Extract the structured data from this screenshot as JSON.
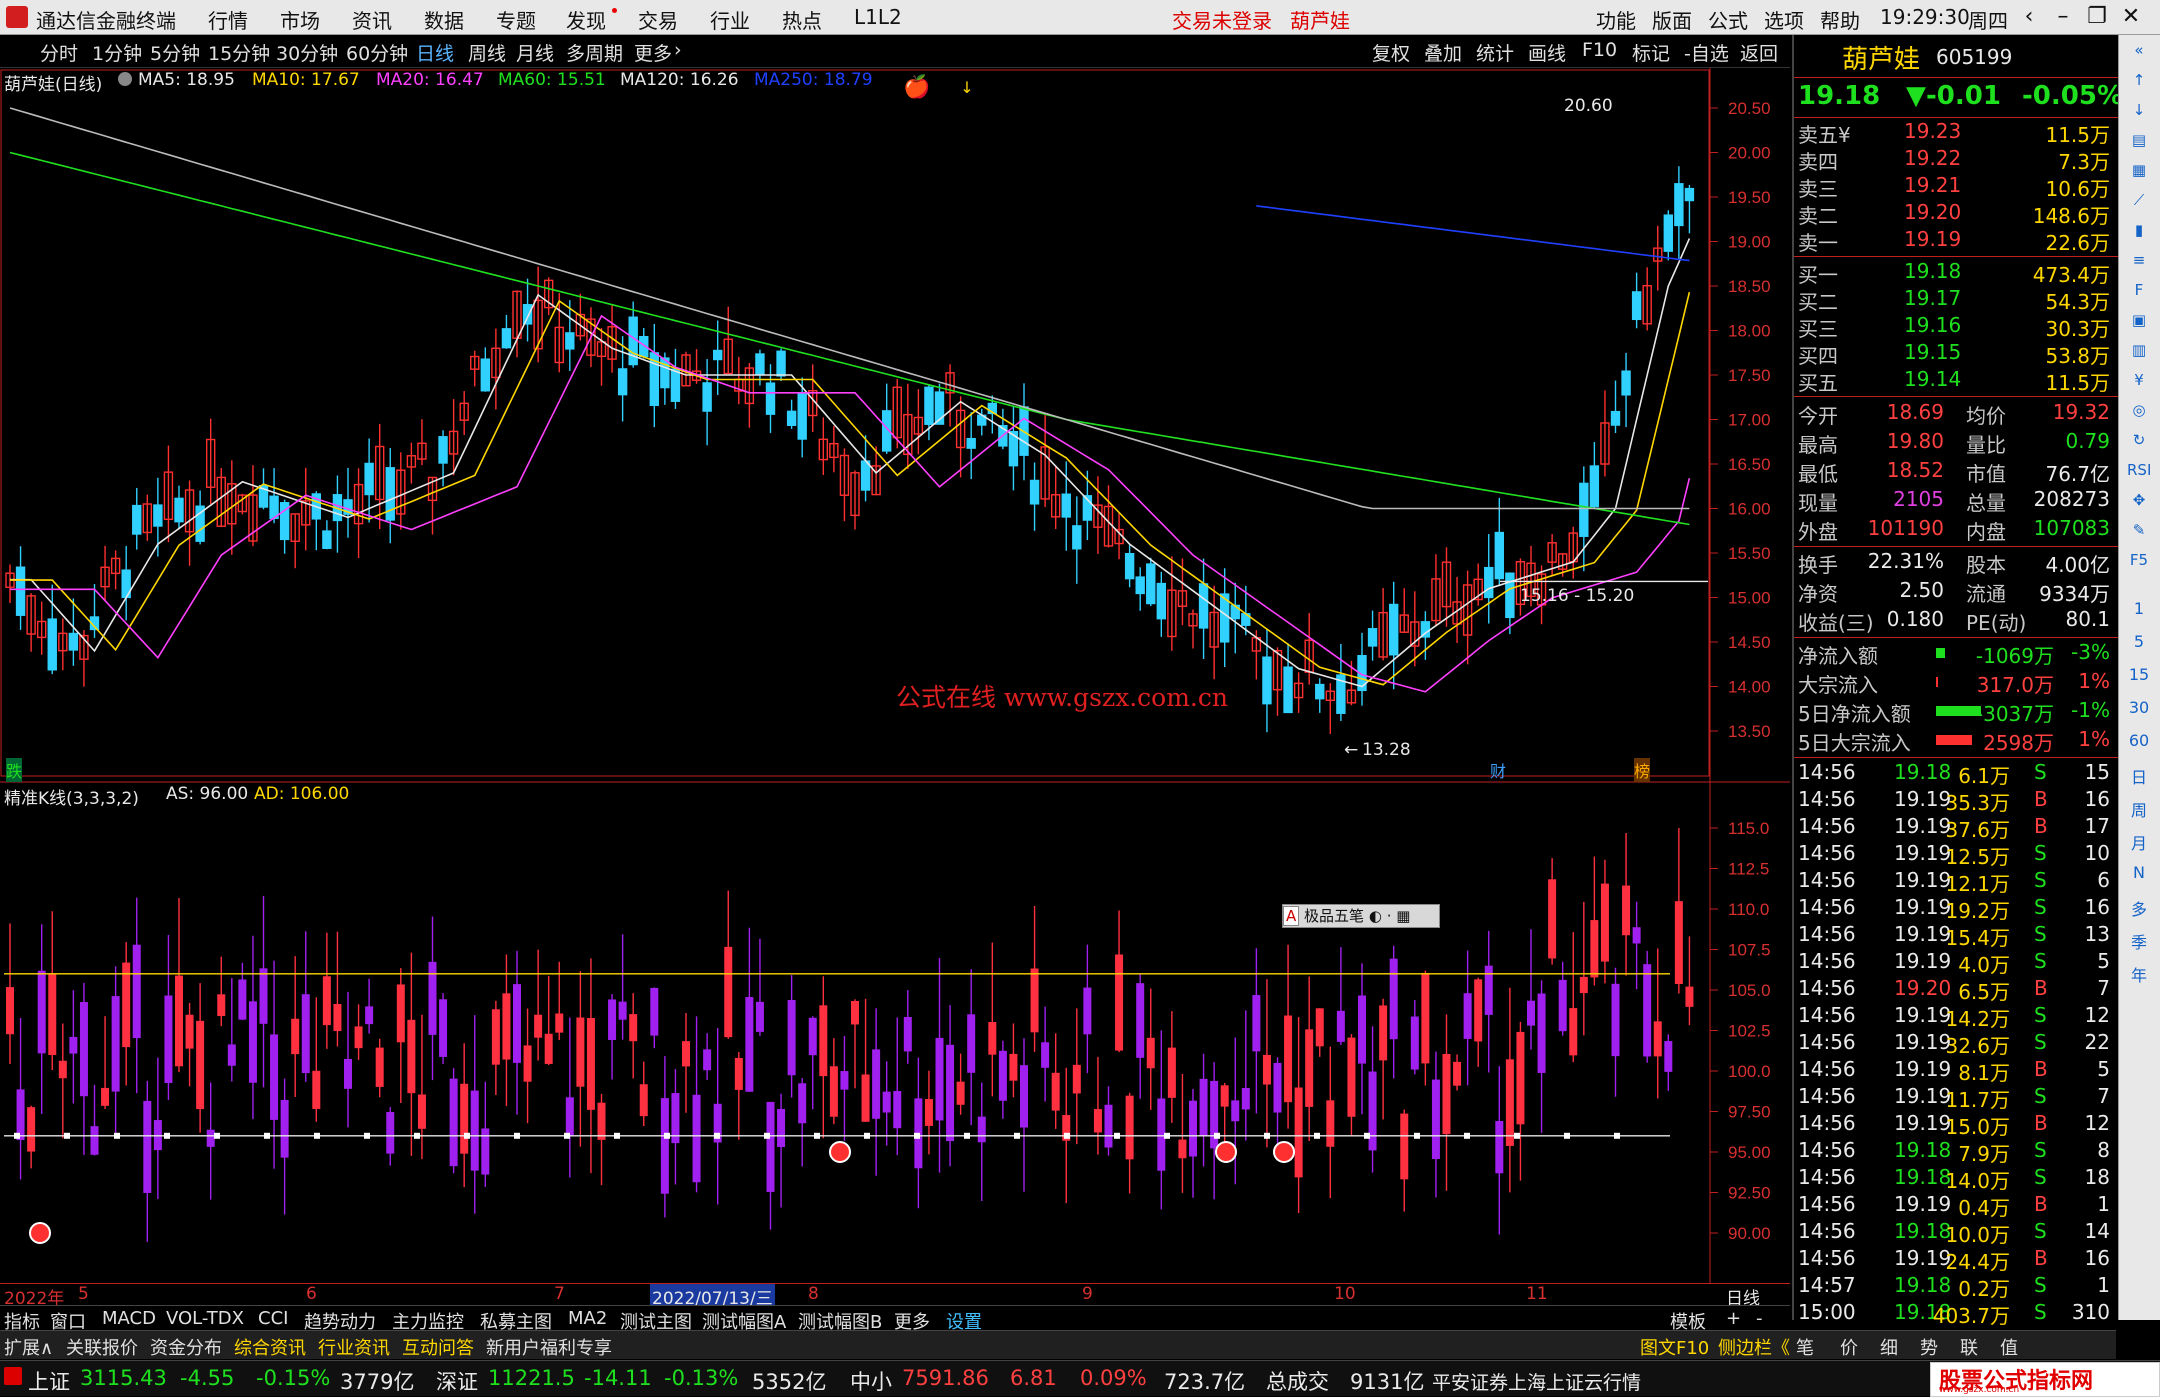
{
  "titlebar": {
    "app_title": "通达信金融终端",
    "menus": [
      "行情",
      "市场",
      "资讯",
      "数据",
      "专题",
      "发现",
      "交易",
      "行业",
      "热点",
      "L1L2"
    ],
    "login_status": "交易未登录",
    "stock_name": "葫芦娃",
    "right_menus": [
      "功能",
      "版面",
      "公式",
      "选项",
      "帮助"
    ],
    "time": "19:29:30",
    "weekday": "周四"
  },
  "toolbar": {
    "periods": [
      "分时",
      "1分钟",
      "5分钟",
      "15分钟",
      "30分钟",
      "60分钟",
      "日线",
      "周线",
      "月线",
      "多周期",
      "更多"
    ],
    "active_period": "日线",
    "right_buttons": [
      "复权",
      "叠加",
      "统计",
      "画线",
      "F10",
      "标记",
      "-自选",
      "返回"
    ]
  },
  "chart": {
    "stock_title": "葫芦娃(日线)",
    "ma_legend": [
      {
        "label": "MA5: 18.95",
        "color": "#e8e8e8"
      },
      {
        "label": "MA10: 17.67",
        "color": "#ffd700"
      },
      {
        "label": "MA20: 16.47",
        "color": "#ff40ff"
      },
      {
        "label": "MA60: 15.51",
        "color": "#20e020"
      },
      {
        "label": "MA120: 16.26",
        "color": "#e8e8e8"
      },
      {
        "label": "MA250: 18.79",
        "color": "#2040ff"
      }
    ],
    "price_axis": [
      "20.50",
      "20.00",
      "19.50",
      "19.00",
      "18.50",
      "18.00",
      "17.50",
      "17.00",
      "16.50",
      "16.00",
      "15.50",
      "15.00",
      "14.50",
      "14.00",
      "13.50"
    ],
    "high_marker": "20.60",
    "low_marker": "13.28",
    "range_label": "15.16 - 15.20",
    "watermark": "公式在线  www.gszx.com.cn",
    "tag_left": "跌",
    "tag_cai": "财",
    "tag_bang": "榜",
    "indicator_title": "精准K线(3,3,3,2)",
    "indicator_as": "AS: 96.00",
    "indicator_ad": "AD: 106.00",
    "indicator_axis": [
      "115.0",
      "112.5",
      "110.0",
      "107.5",
      "105.0",
      "102.5",
      "100.0",
      "97.50",
      "95.00",
      "92.50",
      "90.00"
    ],
    "ime_label": "极品五笔",
    "date_axis": [
      "2022年",
      "5",
      "6",
      "7",
      "2022/07/13/三",
      "8",
      "9",
      "10",
      "11"
    ],
    "date_axis_right": "日线"
  },
  "bottom_tabs": [
    "指标",
    "窗口",
    "MACD",
    "VOL-TDX",
    "CCI",
    "趋势动力",
    "主力监控",
    "私募主图",
    "MA2",
    "测试主图",
    "测试幅图A",
    "测试幅图B",
    "更多",
    "设置"
  ],
  "bottom_tabs_right": [
    "模板",
    "+",
    "-"
  ],
  "second_bar": [
    {
      "label": "扩展∧",
      "color": "#e0e0e0"
    },
    {
      "label": "关联报价",
      "color": "#e0e0e0"
    },
    {
      "label": "资金分布",
      "color": "#e0e0e0"
    },
    {
      "label": "综合资讯",
      "color": "#ffd700"
    },
    {
      "label": "行业资讯",
      "color": "#ffd700"
    },
    {
      "label": "互动问答",
      "color": "#ffd700"
    },
    {
      "label": "新用户福利专享",
      "color": "#e0e0e0"
    }
  ],
  "second_bar_right": [
    "图文F10",
    "侧边栏《",
    "笔",
    "价",
    "细",
    "势",
    "联",
    "值"
  ],
  "status": {
    "sh_label": "上证",
    "sh_value": "3115.43",
    "sh_change": "-4.55",
    "sh_pct": "-0.15%",
    "sh_amount": "3779亿",
    "sz_label": "深证",
    "sz_value": "11221.5",
    "sz_change": "-14.11",
    "sz_pct": "-0.13%",
    "sz_amount": "5352亿",
    "zx_label": "中小",
    "zx_value": "7591.86",
    "zx_change": "6.81",
    "zx_pct": "0.09%",
    "zx_amount": "723.7亿",
    "total_label": "总成交",
    "total_value": "9131亿",
    "broker": "平安证券上海上证云行情",
    "brand": "股票公式指标网",
    "brand_url": "www.gszx.com.cn"
  },
  "quote": {
    "name": "葫芦娃",
    "code": "605199",
    "price": "19.18",
    "change": "▼-0.01",
    "pct": "-0.05%",
    "sells": [
      {
        "label": "卖五¥",
        "price": "19.23",
        "vol": "11.5万"
      },
      {
        "label": "卖四",
        "price": "19.22",
        "vol": "7.3万"
      },
      {
        "label": "卖三",
        "price": "19.21",
        "vol": "10.6万"
      },
      {
        "label": "卖二",
        "price": "19.20",
        "vol": "148.6万"
      },
      {
        "label": "卖一",
        "price": "19.19",
        "vol": "22.6万"
      }
    ],
    "buys": [
      {
        "label": "买一",
        "price": "19.18",
        "vol": "473.4万"
      },
      {
        "label": "买二",
        "price": "19.17",
        "vol": "54.3万"
      },
      {
        "label": "买三",
        "price": "19.16",
        "vol": "30.3万"
      },
      {
        "label": "买四",
        "price": "19.15",
        "vol": "53.8万"
      },
      {
        "label": "买五",
        "price": "19.14",
        "vol": "11.5万"
      }
    ],
    "stats": [
      {
        "l1": "今开",
        "v1": "18.69",
        "c1": "red",
        "l2": "均价",
        "v2": "19.32",
        "c2": "red"
      },
      {
        "l1": "最高",
        "v1": "19.80",
        "c1": "red",
        "l2": "量比",
        "v2": "0.79",
        "c2": "green"
      },
      {
        "l1": "最低",
        "v1": "18.52",
        "c1": "red",
        "l2": "市值",
        "v2": "76.7亿",
        "c2": "white"
      },
      {
        "l1": "现量",
        "v1": "2105",
        "c1": "purple",
        "l2": "总量",
        "v2": "208273",
        "c2": "white"
      },
      {
        "l1": "外盘",
        "v1": "101190",
        "c1": "red",
        "l2": "内盘",
        "v2": "107083",
        "c2": "green"
      }
    ],
    "stats2": [
      {
        "l1": "换手",
        "v1": "22.31%",
        "l2": "股本",
        "v2": "4.00亿"
      },
      {
        "l1": "净资",
        "v1": "2.50",
        "l2": "流通",
        "v2": "9334万"
      },
      {
        "l1": "收益(三)",
        "v1": "0.180",
        "l2": "PE(动)",
        "v2": "80.1"
      }
    ],
    "flows": [
      {
        "label": "净流入额",
        "value": "-1069万",
        "pct": "-3%",
        "color": "green",
        "bar": 0.15
      },
      {
        "label": "大宗流入",
        "value": "317.0万",
        "pct": "1%",
        "color": "red",
        "bar": 0.03
      },
      {
        "label": "5日净流入额",
        "value": "-3037万",
        "pct": "-1%",
        "color": "green",
        "bar": 0.75
      },
      {
        "label": "5日大宗流入",
        "value": "2598万",
        "pct": "1%",
        "color": "red",
        "bar": 0.6
      }
    ],
    "ticks": [
      {
        "t": "14:56",
        "p": "19.18",
        "v": "6.1万",
        "s": "S",
        "n": "15",
        "pc": "green"
      },
      {
        "t": "14:56",
        "p": "19.19",
        "v": "35.3万",
        "s": "B",
        "n": "16",
        "pc": "white"
      },
      {
        "t": "14:56",
        "p": "19.19",
        "v": "37.6万",
        "s": "B",
        "n": "17",
        "pc": "white"
      },
      {
        "t": "14:56",
        "p": "19.19",
        "v": "12.5万",
        "s": "S",
        "n": "10",
        "pc": "white"
      },
      {
        "t": "14:56",
        "p": "19.19",
        "v": "12.1万",
        "s": "S",
        "n": "6",
        "pc": "white"
      },
      {
        "t": "14:56",
        "p": "19.19",
        "v": "19.2万",
        "s": "S",
        "n": "16",
        "pc": "white"
      },
      {
        "t": "14:56",
        "p": "19.19",
        "v": "15.4万",
        "s": "S",
        "n": "13",
        "pc": "white"
      },
      {
        "t": "14:56",
        "p": "19.19",
        "v": "4.0万",
        "s": "S",
        "n": "5",
        "pc": "white"
      },
      {
        "t": "14:56",
        "p": "19.20",
        "v": "6.5万",
        "s": "B",
        "n": "7",
        "pc": "red"
      },
      {
        "t": "14:56",
        "p": "19.19",
        "v": "14.2万",
        "s": "S",
        "n": "12",
        "pc": "white"
      },
      {
        "t": "14:56",
        "p": "19.19",
        "v": "32.6万",
        "s": "S",
        "n": "22",
        "pc": "white"
      },
      {
        "t": "14:56",
        "p": "19.19",
        "v": "8.1万",
        "s": "B",
        "n": "5",
        "pc": "white"
      },
      {
        "t": "14:56",
        "p": "19.19",
        "v": "11.7万",
        "s": "S",
        "n": "7",
        "pc": "white"
      },
      {
        "t": "14:56",
        "p": "19.19",
        "v": "15.0万",
        "s": "B",
        "n": "12",
        "pc": "white"
      },
      {
        "t": "14:56",
        "p": "19.18",
        "v": "7.9万",
        "s": "S",
        "n": "8",
        "pc": "green"
      },
      {
        "t": "14:56",
        "p": "19.18",
        "v": "14.0万",
        "s": "S",
        "n": "18",
        "pc": "green"
      },
      {
        "t": "14:56",
        "p": "19.19",
        "v": "0.4万",
        "s": "B",
        "n": "1",
        "pc": "white"
      },
      {
        "t": "14:56",
        "p": "19.18",
        "v": "10.0万",
        "s": "S",
        "n": "14",
        "pc": "green"
      },
      {
        "t": "14:56",
        "p": "19.19",
        "v": "24.4万",
        "s": "B",
        "n": "16",
        "pc": "white"
      },
      {
        "t": "14:57",
        "p": "19.18",
        "v": "0.2万",
        "s": "S",
        "n": "1",
        "pc": "green"
      },
      {
        "t": "15:00",
        "p": "19.18",
        "v": "403.7万",
        "s": "S",
        "n": "310",
        "pc": "green"
      }
    ]
  },
  "sidebar_icons": [
    "collapse-icon",
    "up-icon",
    "down-icon",
    "chart-icon",
    "table-icon",
    "trend-icon",
    "candle-icon",
    "list-icon",
    "f10-icon",
    "doc-icon",
    "grid-icon",
    "fund-icon",
    "target-icon",
    "cycle-icon",
    "rsi-icon",
    "move-icon",
    "pen-icon",
    "f5-icon"
  ],
  "sidebar_labels": [
    "1",
    "5",
    "15",
    "30",
    "60",
    "日",
    "周",
    "月",
    "N",
    "多",
    "季",
    "年"
  ],
  "sidebar_texts": [
    "RSI",
    "F5"
  ],
  "colors": {
    "up": "#ff3030",
    "down": "#30d0ff",
    "ind_up": "#ff3040",
    "ind_down": "#a020f0"
  }
}
